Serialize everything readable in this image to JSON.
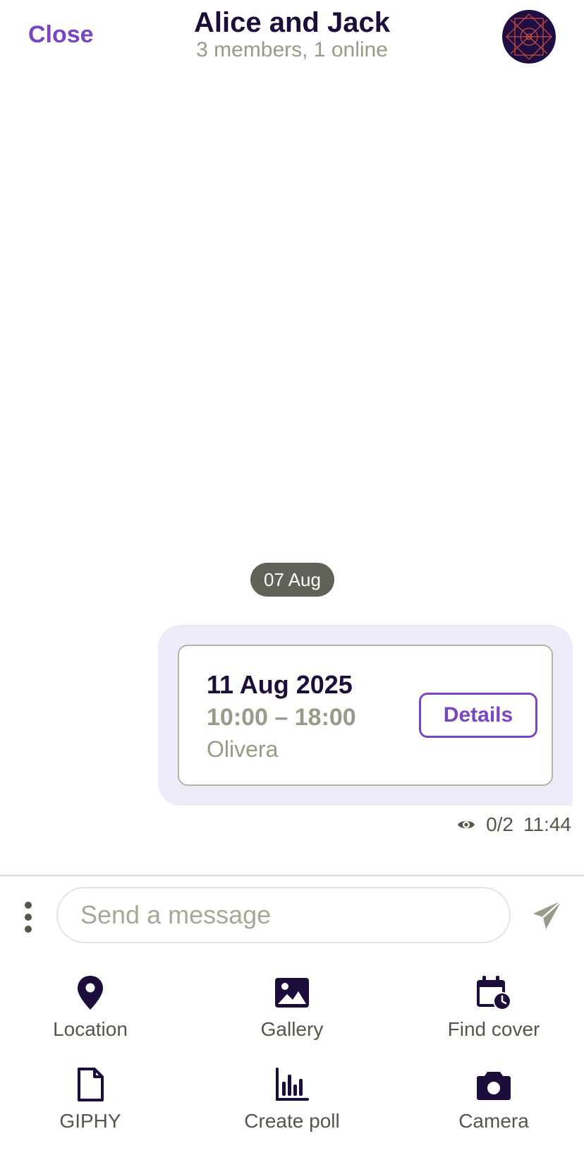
{
  "header": {
    "close_label": "Close",
    "title": "Alice  and Jack",
    "subtitle": "3 members, 1 online"
  },
  "date_separator": "07 Aug",
  "message": {
    "event": {
      "date": "11 Aug 2025",
      "time": "10:00 – 18:00",
      "location": "Olivera",
      "details_label": "Details"
    },
    "views": "0/2",
    "time": "11:44"
  },
  "composer": {
    "placeholder": "Send a message"
  },
  "actions": [
    {
      "label": "Location",
      "icon": "location-pin-icon"
    },
    {
      "label": "Gallery",
      "icon": "image-icon"
    },
    {
      "label": "Find cover",
      "icon": "calendar-clock-icon"
    },
    {
      "label": "GIPHY",
      "icon": "file-icon"
    },
    {
      "label": "Create poll",
      "icon": "bar-chart-icon"
    },
    {
      "label": "Camera",
      "icon": "camera-icon"
    }
  ],
  "colors": {
    "accent": "#7a45c4",
    "title": "#1c0d3a",
    "muted": "#9a9a88",
    "bubble": "#efebfb",
    "pill": "#616157"
  }
}
